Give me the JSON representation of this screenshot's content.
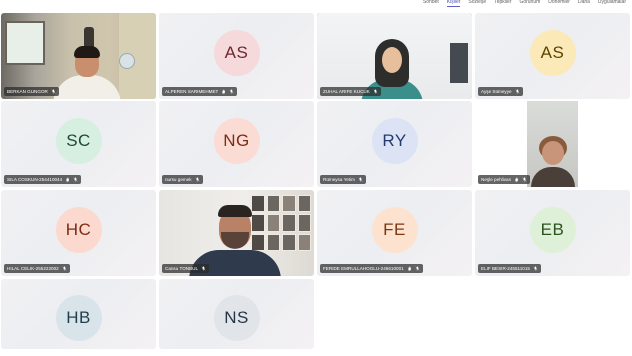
{
  "top_menu": [
    {
      "label": "Sohbet",
      "active": false
    },
    {
      "label": "Kişiler",
      "active": true
    },
    {
      "label": "Sözleşe",
      "active": false
    },
    {
      "label": "Tepkiler",
      "active": false
    },
    {
      "label": "Görünüm",
      "active": false
    },
    {
      "label": "Dönemler",
      "active": false
    },
    {
      "label": "Daha",
      "active": false
    },
    {
      "label": "Uygulamalar",
      "active": false
    }
  ],
  "participants": [
    {
      "name": "BERKAN GUNGOR",
      "type": "video",
      "scene": "s1"
    },
    {
      "name": "ALPEREN SARIMEHMET",
      "initials": "AS",
      "avatar_bg": "#f5d9db",
      "avatar_fg": "#6b2930"
    },
    {
      "name": "ZUHAL ARIFE KUCUK",
      "type": "video",
      "scene": "s2",
      "speaking": true
    },
    {
      "name": "Ayşe Sümeyye",
      "initials": "AS",
      "avatar_bg": "#fbe9b7",
      "avatar_fg": "#5c4600"
    },
    {
      "name": "SILA COSKUN-254410044",
      "initials": "SC",
      "avatar_bg": "#d6efe0",
      "avatar_fg": "#1f4a32"
    },
    {
      "name": "nursu gemek",
      "initials": "NG",
      "avatar_bg": "#fbdcd4",
      "avatar_fg": "#7a2c17"
    },
    {
      "name": "Rümeysa Yetim",
      "initials": "RY",
      "avatar_bg": "#dce3f5",
      "avatar_fg": "#263a72"
    },
    {
      "name": "Neşle pehlivan",
      "type": "video",
      "scene": "s3"
    },
    {
      "name": "HILAL CELIK-255222002",
      "initials": "HC",
      "avatar_bg": "#fbd9cf",
      "avatar_fg": "#7d2b13"
    },
    {
      "name": "Cansu TONBUL",
      "type": "video",
      "scene": "s4"
    },
    {
      "name": "FERIDE EMRULLAHOGLU-246610001",
      "initials": "FE",
      "avatar_bg": "#fde2cf",
      "avatar_fg": "#7a3810"
    },
    {
      "name": "ELIF BESIR-245511015",
      "initials": "EB",
      "avatar_bg": "#dff0d8",
      "avatar_fg": "#2d5221"
    },
    {
      "name": "",
      "initials": "HB",
      "avatar_bg": "#d9e4ea",
      "avatar_fg": "#21404f"
    },
    {
      "name": "",
      "initials": "NS",
      "avatar_bg": "#e1e5ea",
      "avatar_fg": "#263544"
    }
  ]
}
